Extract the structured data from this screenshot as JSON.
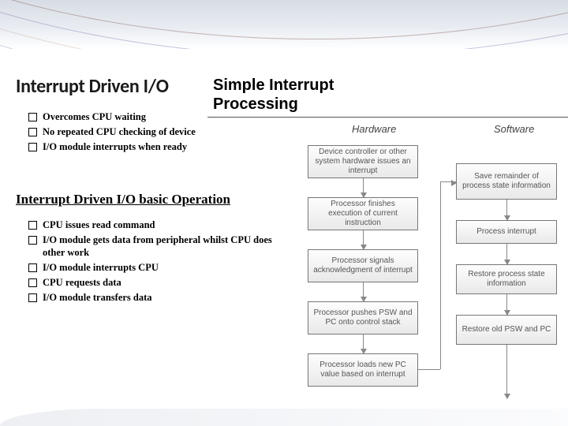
{
  "title": "Interrupt Driven I/O",
  "bullets_top": [
    "Overcomes CPU waiting",
    "No repeated CPU checking of device",
    "I/O module interrupts when ready"
  ],
  "subtitle": "Interrupt Driven I/O basic Operation",
  "bullets_bottom": [
    "CPU issues read command",
    "I/O module gets data from peripheral whilst CPU does other work",
    "I/O module interrupts CPU",
    "CPU requests data",
    "I/O module transfers data"
  ],
  "diagram": {
    "title": "Simple Interrupt\nProcessing",
    "col_hw": "Hardware",
    "col_sw": "Software",
    "hw_boxes": [
      "Device controller or other system hardware issues an interrupt",
      "Processor finishes execution of current instruction",
      "Processor signals acknowledgment of interrupt",
      "Processor pushes PSW and PC onto control stack",
      "Processor loads new PC value based on interrupt"
    ],
    "sw_boxes": [
      "Save remainder of process state information",
      "Process interrupt",
      "Restore process state information",
      "Restore old PSW and PC"
    ]
  }
}
